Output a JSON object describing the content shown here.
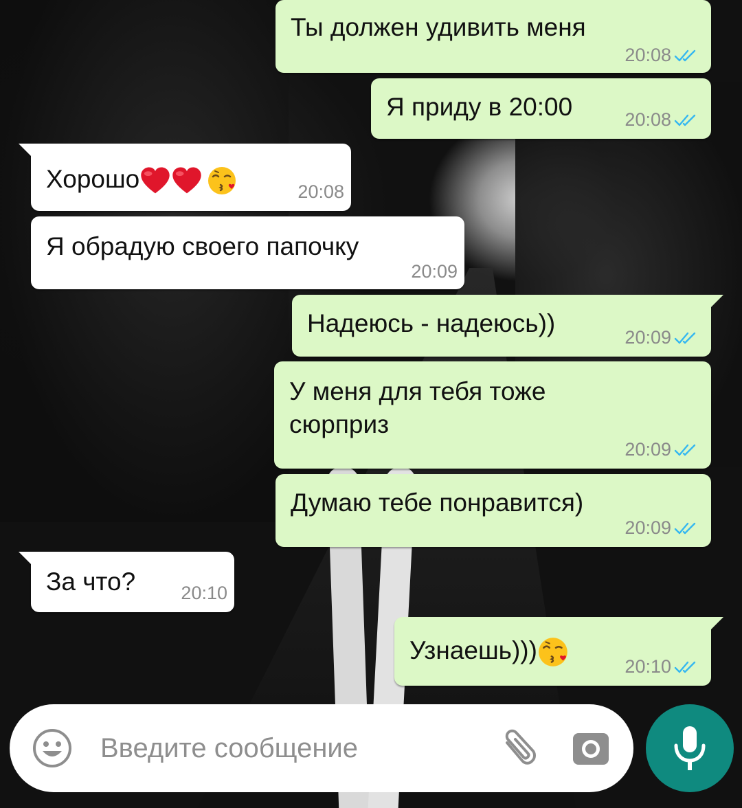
{
  "colors": {
    "outgoing_bubble": "#dcf8c6",
    "incoming_bubble": "#ffffff",
    "read_ticks": "#34b7f1",
    "timestamp": "#8a8a8a",
    "mic_button": "#0f8a7f"
  },
  "messages": [
    {
      "direction": "outgoing",
      "text": "Ты должен удивить меня",
      "time": "20:08",
      "status": "read"
    },
    {
      "direction": "outgoing",
      "text": "Я приду в 20:00",
      "time": "20:08",
      "status": "read"
    },
    {
      "direction": "incoming",
      "text": "Хорошо",
      "emojis": [
        "red-heart",
        "red-heart",
        "face-blowing-kiss"
      ],
      "time": "20:08"
    },
    {
      "direction": "incoming",
      "text": "Я обрадую своего папочку",
      "time": "20:09"
    },
    {
      "direction": "outgoing",
      "text": "Надеюсь - надеюсь))",
      "time": "20:09",
      "status": "read"
    },
    {
      "direction": "outgoing",
      "text_lines": [
        "У меня для тебя тоже",
        "сюрприз"
      ],
      "time": "20:09",
      "status": "read"
    },
    {
      "direction": "outgoing",
      "text": "Думаю тебе понравится)",
      "time": "20:09",
      "status": "read"
    },
    {
      "direction": "incoming",
      "text": "За что?",
      "time": "20:10"
    },
    {
      "direction": "outgoing",
      "text": "Узнаешь)))",
      "emojis": [
        "face-blowing-kiss"
      ],
      "time": "20:10",
      "status": "read"
    }
  ],
  "composer": {
    "placeholder": "Введите сообщение",
    "icons": [
      "smile-icon",
      "paperclip-icon",
      "camera-icon",
      "microphone-icon"
    ]
  }
}
